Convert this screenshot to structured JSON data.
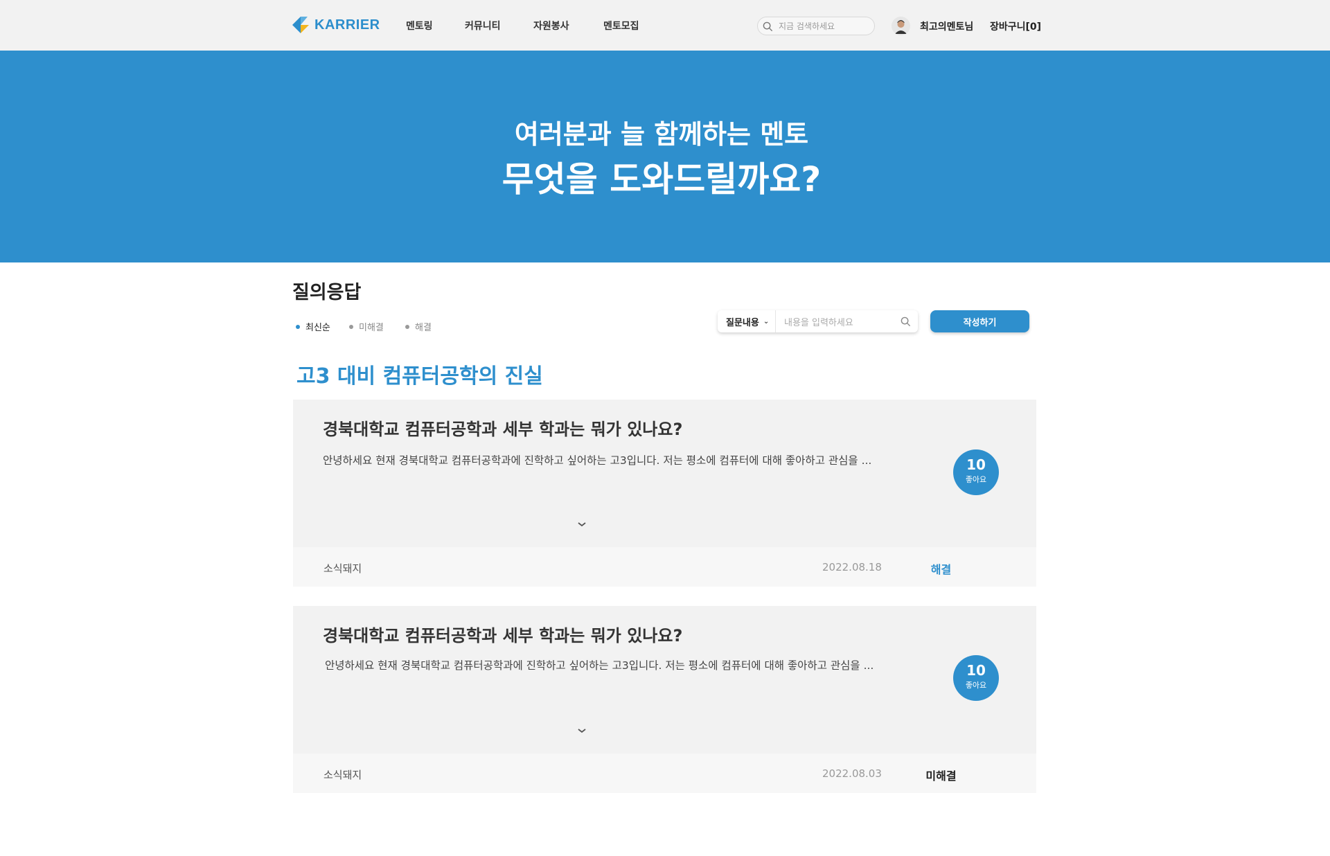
{
  "header": {
    "logo_text": "KARRIER",
    "nav": [
      "멘토링",
      "커뮤니티",
      "자원봉사",
      "멘토모집"
    ],
    "search_placeholder": "지금 검색하세요",
    "username": "최고의멘토님",
    "cart": "장바구니[0]"
  },
  "hero": {
    "line1": "여러분과 늘 함께하는 멘토",
    "line2": "무엇을 도와드릴까요?"
  },
  "qa": {
    "title": "질의응답",
    "filters": [
      "최신순",
      "미해결",
      "해결"
    ],
    "active_filter": "최신순",
    "search_select": "질문내용",
    "search_placeholder": "내용을 입력하세요",
    "write_button": "작성하기"
  },
  "topic": "고3 대비 컴퓨터공학의 진실",
  "posts": [
    {
      "title": "경북대학교 컴퓨터공학과 세부 학과는 뭐가 있나요?",
      "excerpt": "안녕하세요 현재 경북대학교 컴퓨터공학과에 진학하고 싶어하는 고3입니다. 저는 평소에 컴퓨터에 대해 좋아하고 관심을 ...",
      "likes": "10",
      "likes_label": "좋아요",
      "author": "소식돼지",
      "date": "2022.08.18",
      "status": "해결",
      "status_color": "#2e8fcd"
    },
    {
      "title": "경북대학교 컴퓨터공학과 세부 학과는 뭐가 있나요?",
      "excerpt": "안녕하세요 현재 경북대학교 컴퓨터공학과에 진학하고 싶어하는 고3입니다. 저는 평소에 컴퓨터에 대해 좋아하고 관심을 ...",
      "likes": "10",
      "likes_label": "좋아요",
      "author": "소식돼지",
      "date": "2022.08.03",
      "status": "미해결",
      "status_color": "#222222"
    }
  ],
  "colors": {
    "accent": "#2e8fcd",
    "header_bg": "#f2f2f2",
    "card_bg": "#f2f2f2",
    "card_foot_bg": "#f7f7f7"
  }
}
